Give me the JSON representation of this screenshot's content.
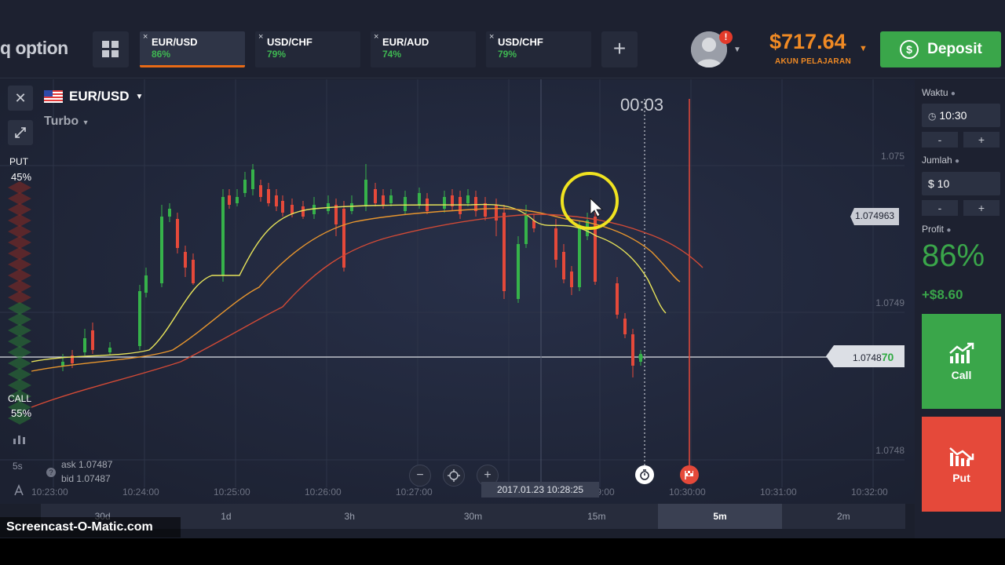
{
  "header": {
    "logo": "q option",
    "tabs": [
      {
        "symbol": "EUR/USD",
        "pct": "86%",
        "active": true
      },
      {
        "symbol": "USD/CHF",
        "pct": "79%",
        "active": false
      },
      {
        "symbol": "EUR/AUD",
        "pct": "74%",
        "active": false
      },
      {
        "symbol": "USD/CHF",
        "pct": "79%",
        "active": false
      }
    ],
    "tab_close": "×",
    "add_tab": "+",
    "notification_count": "!",
    "balance": "$717.64",
    "account_label": "AKUN PELAJARAN",
    "deposit_label": "Deposit"
  },
  "left_panel": {
    "put_label": "PUT",
    "put_pct": "45%",
    "call_label": "CALL",
    "call_pct": "55%",
    "interval_label": "5s"
  },
  "chart": {
    "asset": "EUR/USD",
    "mode": "Turbo",
    "countdown": "00:03",
    "price_current": "1.074963",
    "price_line_main": "1.0748",
    "price_line_suffix": "70",
    "y_labels": [
      "1.075",
      "1.0749",
      "1.0748"
    ],
    "x_labels": [
      "10:23:00",
      "10:24:00",
      "10:25:00",
      "10:26:00",
      "10:27:00",
      "10:29:00",
      "10:30:00",
      "10:31:00",
      "10:32:00"
    ],
    "ask": "ask 1.07487",
    "bid": "bid 1.07487",
    "zoom_out": "−",
    "zoom_in": "+",
    "crosshair_date": "2017.01.23 10:28:25",
    "colors": {
      "up": "#36b24a",
      "down": "#e5493a",
      "ma_fast": "#e7e35a",
      "ma_mid": "#e8962e",
      "ma_slow": "#d24a36"
    }
  },
  "periods": [
    {
      "label": "30d",
      "active": false
    },
    {
      "label": "1d",
      "active": false
    },
    {
      "label": "3h",
      "active": false
    },
    {
      "label": "30m",
      "active": false
    },
    {
      "label": "15m",
      "active": false
    },
    {
      "label": "5m",
      "active": true
    },
    {
      "label": "2m",
      "active": false
    }
  ],
  "trade": {
    "time_label": "Waktu",
    "time_value": "10:30",
    "amount_label": "Jumlah",
    "amount_value": "$ 10",
    "minus": "-",
    "plus": "+",
    "profit_label": "Profit",
    "profit_pct": "86%",
    "profit_amount": "+$8.60",
    "call_label": "Call",
    "put_label": "Put"
  },
  "watermark": "Screencast-O-Matic.com"
}
